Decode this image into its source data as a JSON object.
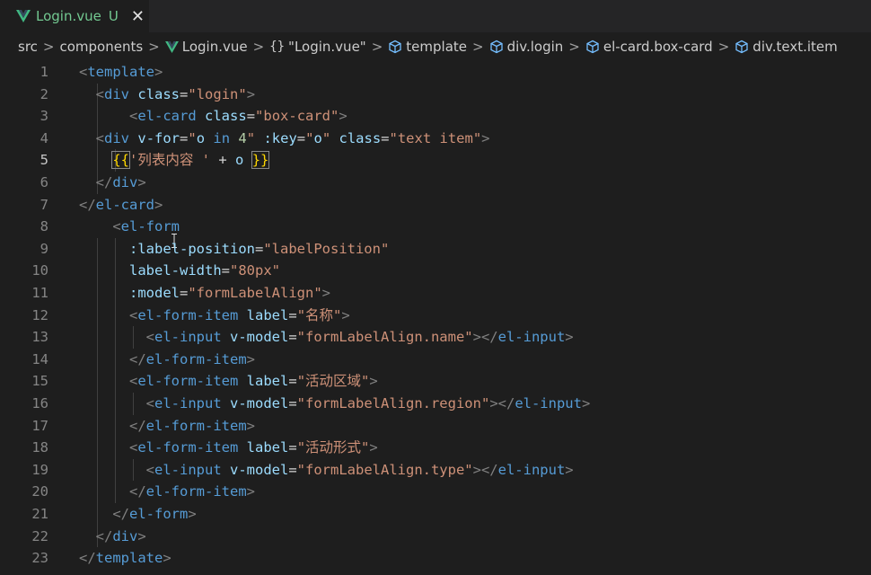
{
  "tab": {
    "title": "Login.vue",
    "status": "U",
    "close": "✕"
  },
  "breadcrumb": {
    "items": [
      "src",
      "components",
      "Login.vue",
      "\"Login.vue\"",
      "template",
      "div.login",
      "el-card.box-card",
      "div.text.item"
    ],
    "separator": ">",
    "braces": "{}"
  },
  "colors": {
    "tag": "#569cd6",
    "attribute": "#9cdcfe",
    "string": "#ce9178",
    "punctuation": "#808080",
    "modified": "#73c991",
    "vue_green": "#41b883"
  },
  "editor": {
    "lines": [
      {
        "n": "1",
        "tokens": [
          [
            "t-punct",
            "<"
          ],
          [
            "t-tag",
            "template"
          ],
          [
            "t-punct",
            ">"
          ]
        ]
      },
      {
        "n": "2",
        "tokens": [
          [
            "t-text",
            "  "
          ],
          [
            "t-punct",
            "<"
          ],
          [
            "t-tag",
            "div"
          ],
          [
            "t-text",
            " "
          ],
          [
            "t-attr",
            "class"
          ],
          [
            "t-text",
            "="
          ],
          [
            "t-str",
            "\"login\""
          ],
          [
            "t-punct",
            ">"
          ]
        ]
      },
      {
        "n": "3",
        "tokens": [
          [
            "t-text",
            "      "
          ],
          [
            "t-punct",
            "<"
          ],
          [
            "t-tag",
            "el-card"
          ],
          [
            "t-text",
            " "
          ],
          [
            "t-attr",
            "class"
          ],
          [
            "t-text",
            "="
          ],
          [
            "t-str",
            "\"box-card\""
          ],
          [
            "t-punct",
            ">"
          ]
        ]
      },
      {
        "n": "4",
        "tokens": [
          [
            "t-text",
            "  "
          ],
          [
            "t-punct",
            "<"
          ],
          [
            "t-tag",
            "div"
          ],
          [
            "t-text",
            " "
          ],
          [
            "t-attr",
            "v-for"
          ],
          [
            "t-text",
            "="
          ],
          [
            "t-str",
            "\""
          ],
          [
            "t-attr",
            "o"
          ],
          [
            "t-text",
            " "
          ],
          [
            "t-kw",
            "in"
          ],
          [
            "t-text",
            " "
          ],
          [
            "t-num",
            "4"
          ],
          [
            "t-str",
            "\""
          ],
          [
            "t-text",
            " "
          ],
          [
            "t-attr",
            ":key"
          ],
          [
            "t-text",
            "="
          ],
          [
            "t-str",
            "\""
          ],
          [
            "t-attr",
            "o"
          ],
          [
            "t-str",
            "\""
          ],
          [
            "t-text",
            " "
          ],
          [
            "t-attr",
            "class"
          ],
          [
            "t-text",
            "="
          ],
          [
            "t-str",
            "\"text item\""
          ],
          [
            "t-punct",
            ">"
          ]
        ]
      },
      {
        "n": "5",
        "tokens": [
          [
            "t-text",
            "    "
          ],
          [
            "t-brace",
            "{{"
          ],
          [
            "t-str",
            "'列表内容 '"
          ],
          [
            "t-text",
            " + "
          ],
          [
            "t-attr",
            "o"
          ],
          [
            "t-text",
            " "
          ],
          [
            "t-brace",
            "}}"
          ]
        ]
      },
      {
        "n": "6",
        "tokens": [
          [
            "t-text",
            "  "
          ],
          [
            "t-punct",
            "</"
          ],
          [
            "t-tag",
            "div"
          ],
          [
            "t-punct",
            ">"
          ]
        ]
      },
      {
        "n": "7",
        "tokens": [
          [
            "t-punct",
            "</"
          ],
          [
            "t-tag",
            "el-card"
          ],
          [
            "t-punct",
            ">"
          ]
        ]
      },
      {
        "n": "8",
        "tokens": [
          [
            "t-text",
            "    "
          ],
          [
            "t-punct",
            "<"
          ],
          [
            "t-tag",
            "el-form"
          ]
        ]
      },
      {
        "n": "9",
        "tokens": [
          [
            "t-text",
            "      "
          ],
          [
            "t-attr",
            ":label-position"
          ],
          [
            "t-text",
            "="
          ],
          [
            "t-str",
            "\"labelPosition\""
          ]
        ]
      },
      {
        "n": "10",
        "tokens": [
          [
            "t-text",
            "      "
          ],
          [
            "t-attr",
            "label-width"
          ],
          [
            "t-text",
            "="
          ],
          [
            "t-str",
            "\"80px\""
          ]
        ]
      },
      {
        "n": "11",
        "tokens": [
          [
            "t-text",
            "      "
          ],
          [
            "t-attr",
            ":model"
          ],
          [
            "t-text",
            "="
          ],
          [
            "t-str",
            "\"formLabelAlign\""
          ],
          [
            "t-punct",
            ">"
          ]
        ]
      },
      {
        "n": "12",
        "tokens": [
          [
            "t-text",
            "      "
          ],
          [
            "t-punct",
            "<"
          ],
          [
            "t-tag",
            "el-form-item"
          ],
          [
            "t-text",
            " "
          ],
          [
            "t-attr",
            "label"
          ],
          [
            "t-text",
            "="
          ],
          [
            "t-str",
            "\"名称\""
          ],
          [
            "t-punct",
            ">"
          ]
        ]
      },
      {
        "n": "13",
        "tokens": [
          [
            "t-text",
            "        "
          ],
          [
            "t-punct",
            "<"
          ],
          [
            "t-tag",
            "el-input"
          ],
          [
            "t-text",
            " "
          ],
          [
            "t-attr",
            "v-model"
          ],
          [
            "t-text",
            "="
          ],
          [
            "t-str",
            "\"formLabelAlign.name\""
          ],
          [
            "t-punct",
            "></"
          ],
          [
            "t-tag",
            "el-input"
          ],
          [
            "t-punct",
            ">"
          ]
        ]
      },
      {
        "n": "14",
        "tokens": [
          [
            "t-text",
            "      "
          ],
          [
            "t-punct",
            "</"
          ],
          [
            "t-tag",
            "el-form-item"
          ],
          [
            "t-punct",
            ">"
          ]
        ]
      },
      {
        "n": "15",
        "tokens": [
          [
            "t-text",
            "      "
          ],
          [
            "t-punct",
            "<"
          ],
          [
            "t-tag",
            "el-form-item"
          ],
          [
            "t-text",
            " "
          ],
          [
            "t-attr",
            "label"
          ],
          [
            "t-text",
            "="
          ],
          [
            "t-str",
            "\"活动区域\""
          ],
          [
            "t-punct",
            ">"
          ]
        ]
      },
      {
        "n": "16",
        "tokens": [
          [
            "t-text",
            "        "
          ],
          [
            "t-punct",
            "<"
          ],
          [
            "t-tag",
            "el-input"
          ],
          [
            "t-text",
            " "
          ],
          [
            "t-attr",
            "v-model"
          ],
          [
            "t-text",
            "="
          ],
          [
            "t-str",
            "\"formLabelAlign.region\""
          ],
          [
            "t-punct",
            "></"
          ],
          [
            "t-tag",
            "el-input"
          ],
          [
            "t-punct",
            ">"
          ]
        ]
      },
      {
        "n": "17",
        "tokens": [
          [
            "t-text",
            "      "
          ],
          [
            "t-punct",
            "</"
          ],
          [
            "t-tag",
            "el-form-item"
          ],
          [
            "t-punct",
            ">"
          ]
        ]
      },
      {
        "n": "18",
        "tokens": [
          [
            "t-text",
            "      "
          ],
          [
            "t-punct",
            "<"
          ],
          [
            "t-tag",
            "el-form-item"
          ],
          [
            "t-text",
            " "
          ],
          [
            "t-attr",
            "label"
          ],
          [
            "t-text",
            "="
          ],
          [
            "t-str",
            "\"活动形式\""
          ],
          [
            "t-punct",
            ">"
          ]
        ]
      },
      {
        "n": "19",
        "tokens": [
          [
            "t-text",
            "        "
          ],
          [
            "t-punct",
            "<"
          ],
          [
            "t-tag",
            "el-input"
          ],
          [
            "t-text",
            " "
          ],
          [
            "t-attr",
            "v-model"
          ],
          [
            "t-text",
            "="
          ],
          [
            "t-str",
            "\"formLabelAlign.type\""
          ],
          [
            "t-punct",
            "></"
          ],
          [
            "t-tag",
            "el-input"
          ],
          [
            "t-punct",
            ">"
          ]
        ]
      },
      {
        "n": "20",
        "tokens": [
          [
            "t-text",
            "      "
          ],
          [
            "t-punct",
            "</"
          ],
          [
            "t-tag",
            "el-form-item"
          ],
          [
            "t-punct",
            ">"
          ]
        ]
      },
      {
        "n": "21",
        "tokens": [
          [
            "t-text",
            "    "
          ],
          [
            "t-punct",
            "</"
          ],
          [
            "t-tag",
            "el-form"
          ],
          [
            "t-punct",
            ">"
          ]
        ]
      },
      {
        "n": "22",
        "tokens": [
          [
            "t-text",
            "  "
          ],
          [
            "t-punct",
            "</"
          ],
          [
            "t-tag",
            "div"
          ],
          [
            "t-punct",
            ">"
          ]
        ]
      },
      {
        "n": "23",
        "tokens": [
          [
            "t-punct",
            "</"
          ],
          [
            "t-tag",
            "template"
          ],
          [
            "t-punct",
            ">"
          ]
        ]
      }
    ]
  }
}
